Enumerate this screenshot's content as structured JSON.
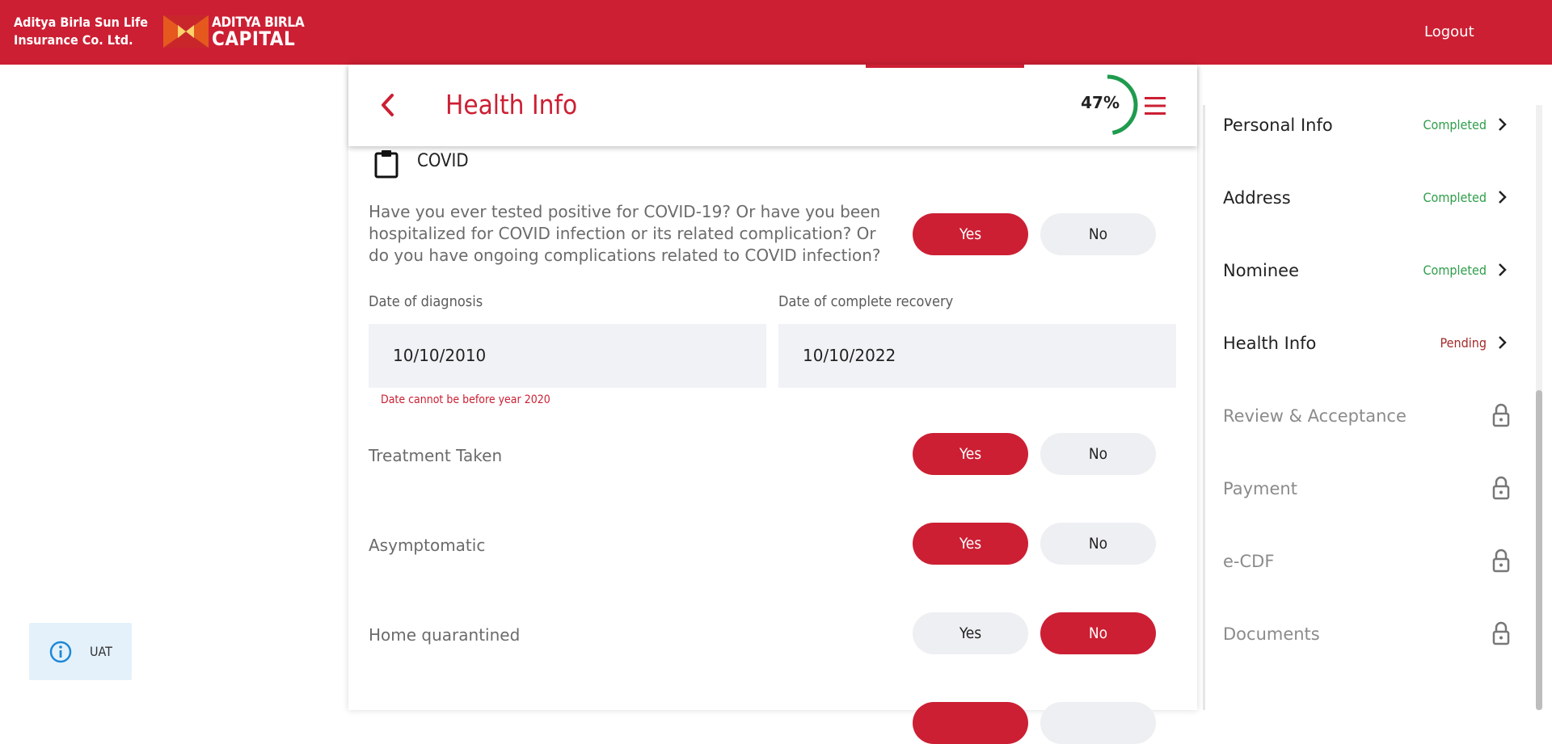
{
  "header": {
    "company_line1": "Aditya Birla Sun Life",
    "company_line2": "Insurance Co. Ltd.",
    "logo_line1": "ADITYA BIRLA",
    "logo_line2": "CAPITAL",
    "logout_label": "Logout",
    "brand_color": "#cc1f33"
  },
  "page": {
    "title": "Health Info",
    "progress_percent": 47,
    "progress_text": "47%",
    "back_icon": "chevron-left-icon",
    "menu_icon": "hamburger-menu-icon"
  },
  "section": {
    "title": "COVID",
    "icon": "clipboard-icon"
  },
  "covid_question": {
    "text": "Have you ever tested positive for COVID-19? Or have you been hospitalized for COVID infection or its related complication? Or do you have ongoing complications related to COVID infection?",
    "yes": "Yes",
    "no": "No",
    "selected": "Yes"
  },
  "fields": {
    "diagnosis_label": "Date of diagnosis",
    "diagnosis_value": "10/10/2010",
    "diagnosis_error": "Date cannot be before year 2020",
    "recovery_label": "Date of complete recovery",
    "recovery_value": "10/10/2022"
  },
  "questions": [
    {
      "label": "Treatment Taken",
      "yes": "Yes",
      "no": "No",
      "selected": "Yes"
    },
    {
      "label": "Asymptomatic",
      "yes": "Yes",
      "no": "No",
      "selected": "Yes"
    },
    {
      "label": "Home quarantined",
      "yes": "Yes",
      "no": "No",
      "selected": "No"
    }
  ],
  "uat": {
    "label": "UAT",
    "icon": "info-icon"
  },
  "sidebar": {
    "items": [
      {
        "label": "Personal Info",
        "status": "Completed",
        "state": "done"
      },
      {
        "label": "Address",
        "status": "Completed",
        "state": "done"
      },
      {
        "label": "Nominee",
        "status": "Completed",
        "state": "done"
      },
      {
        "label": "Health Info",
        "status": "Pending",
        "state": "pending"
      },
      {
        "label": "Review & Acceptance",
        "status": "",
        "state": "locked"
      },
      {
        "label": "Payment",
        "status": "",
        "state": "locked"
      },
      {
        "label": "e-CDF",
        "status": "",
        "state": "locked"
      },
      {
        "label": "Documents",
        "status": "",
        "state": "locked"
      }
    ]
  }
}
